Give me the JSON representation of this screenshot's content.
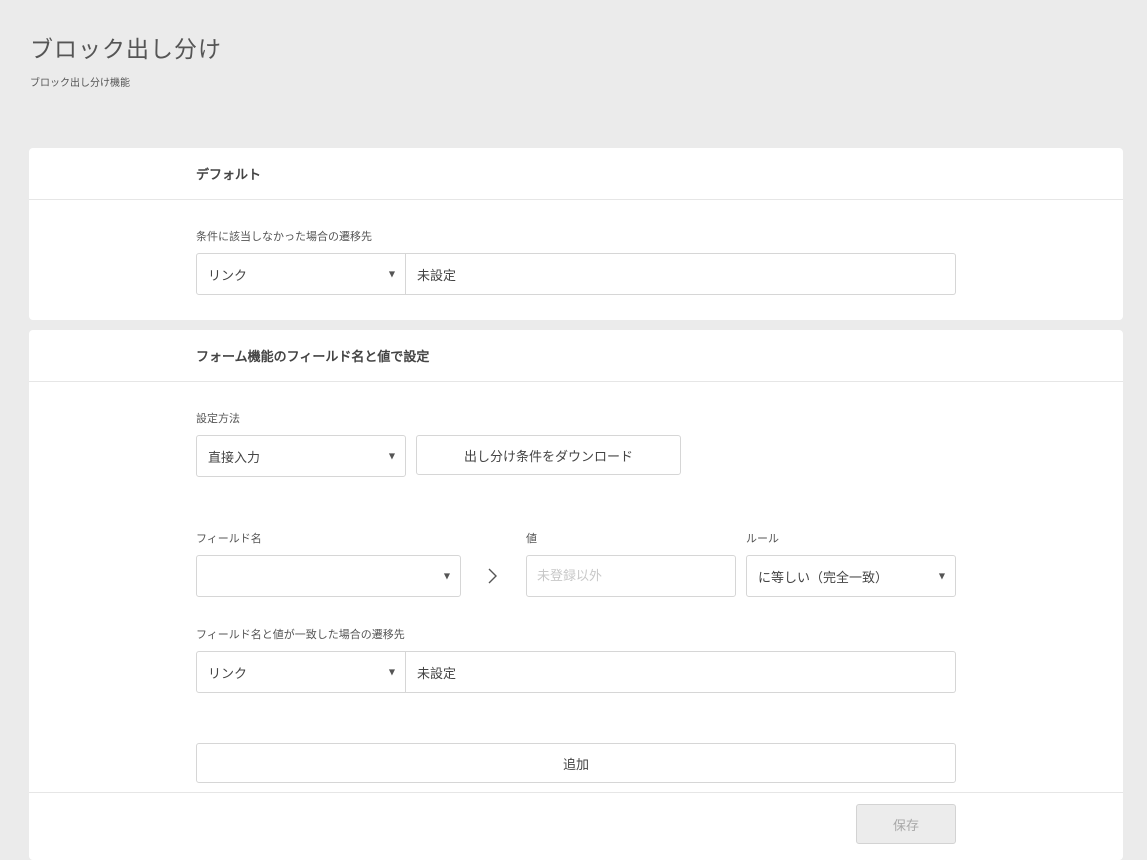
{
  "header": {
    "title": "ブロック出し分け",
    "subtitle": "ブロック出し分け機能"
  },
  "default_section": {
    "title": "デフォルト",
    "destination_label": "条件に該当しなかった場合の遷移先",
    "link_type": "リンク",
    "link_value": "未設定"
  },
  "form_section": {
    "title": "フォーム機能のフィールド名と値で設定",
    "method_label": "設定方法",
    "method_value": "直接入力",
    "download_button": "出し分け条件をダウンロード",
    "field_label": "フィールド名",
    "field_value": "",
    "value_label": "値",
    "value_placeholder": "未登録以外",
    "rule_label": "ルール",
    "rule_value": "に等しい（完全一致）",
    "match_destination_label": "フィールド名と値が一致した場合の遷移先",
    "link_type": "リンク",
    "link_value": "未設定",
    "add_button": "追加",
    "save_button": "保存"
  },
  "icons": {
    "caret": "caret-down-icon",
    "arrow": "chevron-right-icon"
  }
}
